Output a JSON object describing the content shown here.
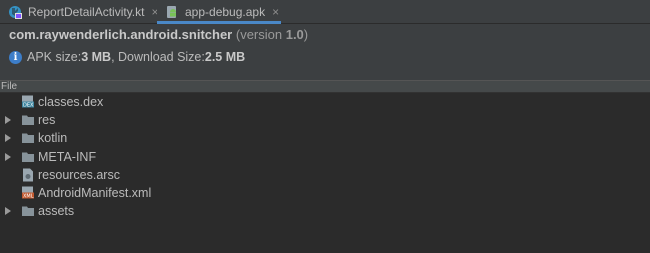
{
  "tabs": [
    {
      "label": "ReportDetailActivity.kt",
      "icon": "kotlin-file-icon",
      "close": "×"
    },
    {
      "label": "app-debug.apk",
      "icon": "android-apk-icon",
      "close": "×"
    }
  ],
  "apk": {
    "package": "com.raywenderlich.android.snitcher",
    "version_prefix": "(version ",
    "version": "1.0",
    "version_suffix": ")",
    "apk_size_label": "APK size: ",
    "apk_size": "3 MB",
    "separator": ", Download Size: ",
    "download_size": "2.5 MB",
    "info_icon_glyph": "i"
  },
  "table": {
    "column_header": "File"
  },
  "tree": [
    {
      "name": "classes.dex",
      "type": "dex",
      "expandable": false
    },
    {
      "name": "res",
      "type": "folder",
      "expandable": true
    },
    {
      "name": "kotlin",
      "type": "folder",
      "expandable": true
    },
    {
      "name": "META-INF",
      "type": "folder",
      "expandable": true
    },
    {
      "name": "resources.arsc",
      "type": "arsc",
      "expandable": false
    },
    {
      "name": "AndroidManifest.xml",
      "type": "xml",
      "expandable": false
    },
    {
      "name": "assets",
      "type": "folder",
      "expandable": true
    }
  ],
  "colors": {
    "background": "#2b2b2b",
    "panel": "#3c3f41",
    "accent": "#4a88c7",
    "folder": "#87939a",
    "dex": "#3e86a0",
    "xml": "#c1592f"
  }
}
